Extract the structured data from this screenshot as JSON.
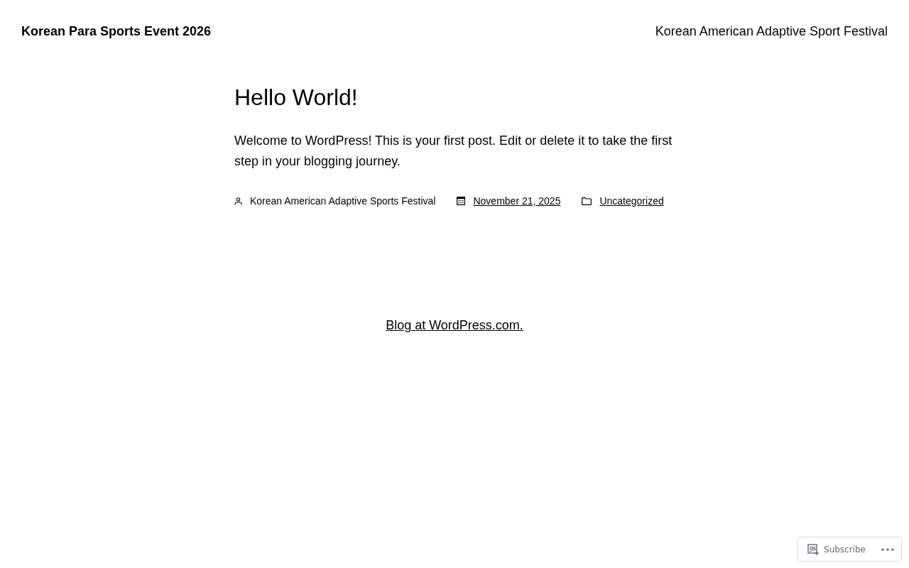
{
  "header": {
    "site_title": "Korean Para Sports Event 2026",
    "nav": [
      {
        "label": "Korean American Adaptive Sport Festival"
      }
    ]
  },
  "post": {
    "title": "Hello World!",
    "body": "Welcome to WordPress! This is your first post. Edit or delete it to take the first step in your blogging journey.",
    "meta": [
      {
        "kind": "author",
        "text": "Korean American Adaptive Sports Festival"
      },
      {
        "kind": "date",
        "text": "November 21, 2025"
      },
      {
        "kind": "category",
        "text": "Uncategorized"
      }
    ]
  },
  "footer": {
    "credit": "Blog at WordPress.com."
  },
  "subscribe_bar": {
    "label": "Subscribe"
  }
}
